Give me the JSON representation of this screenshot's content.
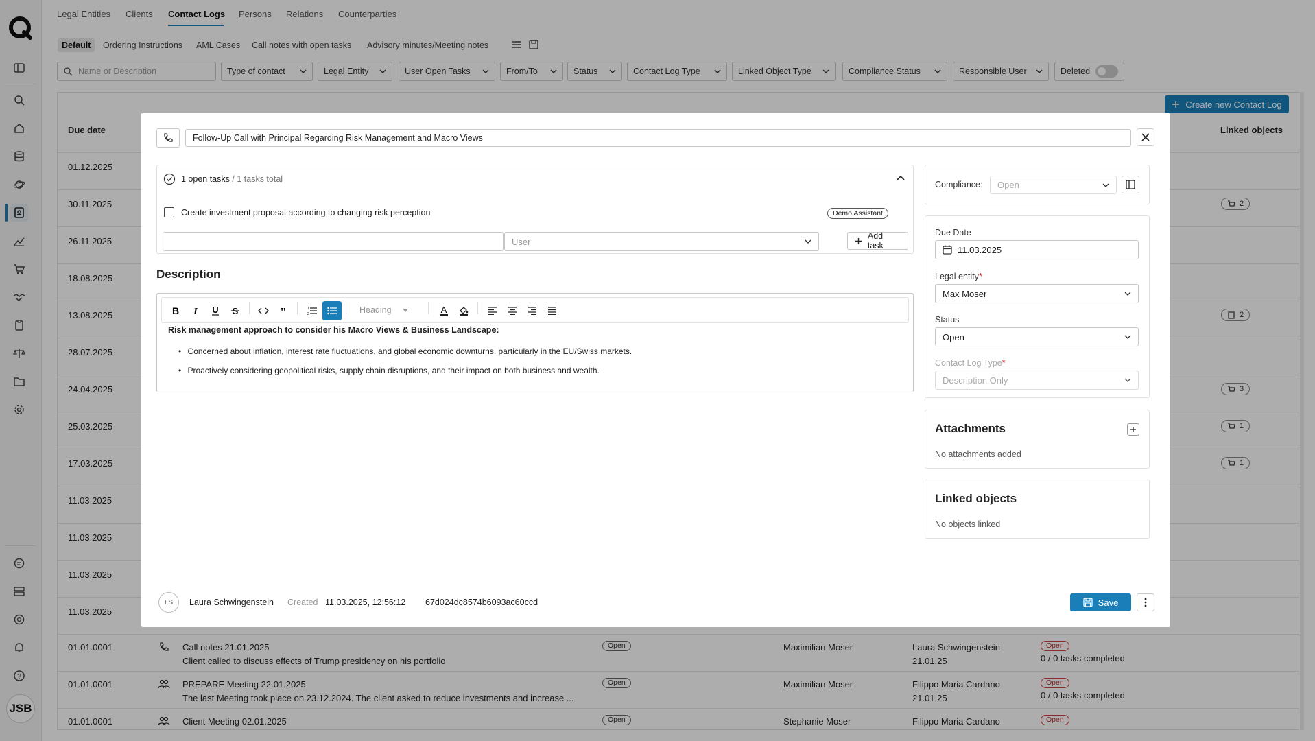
{
  "nav": {
    "tabs": [
      "Legal Entities",
      "Clients",
      "Contact Logs",
      "Persons",
      "Relations",
      "Counterparties"
    ],
    "subtabs": [
      "Default",
      "Ordering Instructions",
      "AML Cases",
      "Call notes with open tasks",
      "Advisory minutes/Meeting notes"
    ]
  },
  "filters": {
    "search_placeholder": "Name or Description",
    "items": [
      "Type of contact",
      "Legal Entity",
      "User Open Tasks",
      "From/To",
      "Status",
      "Contact Log Type",
      "Linked Object Type",
      "Compliance Status",
      "Responsible User"
    ],
    "deleted_label": "Deleted"
  },
  "table": {
    "create_button": "Create new Contact Log",
    "col_due_date": "Due date",
    "col_linked_objects": "Linked objects",
    "dates": [
      "01.12.2025",
      "30.11.2025",
      "26.11.2025",
      "18.08.2025",
      "13.08.2025",
      "28.07.2025",
      "24.04.2025",
      "25.03.2025",
      "17.03.2025",
      "11.03.2025",
      "11.03.2025",
      "11.03.2025",
      "11.03.2025"
    ],
    "linked_counts": [
      "2",
      "2",
      "3",
      "1",
      "1"
    ],
    "bottom_rows": [
      {
        "date": "01.01.0001",
        "title": "Call notes 21.01.2025",
        "desc": "Client called to discuss effects of Trump presidency on his portfolio",
        "status": "Open",
        "person": "Maximilian Moser",
        "user": "Laura Schwingenstein",
        "user_date": "21.01.25",
        "compliance": "Open",
        "tasks": "0 / 0 tasks completed"
      },
      {
        "date": "01.01.0001",
        "title": "PREPARE Meeting 22.01.2025",
        "desc": "The last Meeting took place on 23.12.2024. The client asked to reduce investments and increase ...",
        "status": "Open",
        "person": "Maximilian Moser",
        "user": "Filippo Maria Cardano",
        "user_date": "21.01.25",
        "compliance": "Open",
        "tasks": "0 / 0 tasks completed"
      },
      {
        "date": "01.01.0001",
        "title": "Client Meeting 02.01.2025",
        "desc": "",
        "status": "Open",
        "person": "Stephanie Moser",
        "user": "Filippo Maria Cardano",
        "user_date": "",
        "compliance": "Open",
        "tasks": ""
      }
    ]
  },
  "sidebar": {
    "avatar_initials": "JSB"
  },
  "modal": {
    "title": "Follow-Up Call with Principal Regarding Risk Management and Macro Views",
    "tasks_open": "1 open tasks",
    "tasks_sep": "/",
    "tasks_total": "1 tasks total",
    "task_label": "Create investment proposal according to changing risk perception",
    "task_assignee": "Demo Assistant",
    "user_placeholder": "User",
    "add_task": "Add task",
    "description_heading": "Description",
    "heading_select": "Heading",
    "desc_bold": "Risk management approach to consider his Macro Views & Business Landscape:",
    "desc_bullets": [
      "Concerned about inflation, interest rate fluctuations, and global economic downturns, particularly in the EU/Swiss markets.",
      "Proactively considering geopolitical risks, supply chain disruptions, and their impact on both business and wealth."
    ],
    "compliance_label": "Compliance:",
    "compliance_value": "Open",
    "due_date_label": "Due Date",
    "due_date_value": "11.03.2025",
    "legal_entity_label": "Legal entity",
    "legal_entity_value": "Max Moser",
    "status_label": "Status",
    "status_value": "Open",
    "contact_log_type_label": "Contact Log Type",
    "contact_log_type_value": "Description Only",
    "attachments_heading": "Attachments",
    "attachments_empty": "No attachments added",
    "linked_heading": "Linked objects",
    "linked_empty": "No objects linked",
    "footer_initials": "LS",
    "footer_user": "Laura Schwingenstein",
    "footer_created_label": "Created",
    "footer_created_value": "11.03.2025, 12:56:12",
    "footer_id": "67d024dc8574b6093ac60ccd",
    "save": "Save"
  },
  "colors": {
    "accent": "#1a7fb8",
    "required": "#d02020"
  }
}
